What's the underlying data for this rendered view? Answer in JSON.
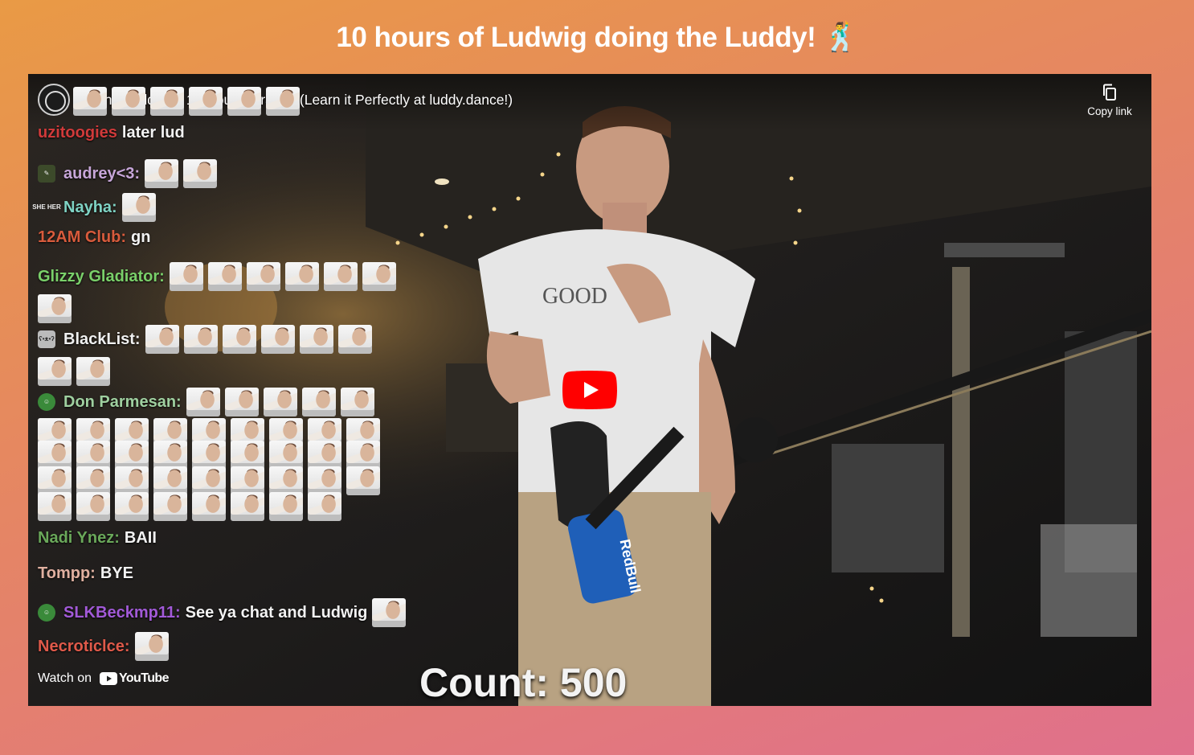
{
  "page": {
    "title": "10 hours of Ludwig doing the Luddy! 🕺"
  },
  "player": {
    "video_title": "The Luddy for 10 Hours Straight (Learn it Perfectly at luddy.dance!)",
    "copy_link_label": "Copy link",
    "watch_on_label": "Watch on",
    "youtube_label": "YouTube",
    "counter_label": "Count: 500",
    "shirt_text": "GOOD",
    "can_text": "RedBull"
  },
  "chat": [
    {
      "user": "uzitoogies",
      "text": "later lud",
      "color": "#d03a3a",
      "badge": ""
    },
    {
      "user": "audrey<3:",
      "text": "",
      "color": "#c7a6d9",
      "badge": "pencil"
    },
    {
      "user": "Nayha:",
      "text": "",
      "color": "#7fd3c4",
      "badge": "pronoun",
      "badge_text": "SHE HER"
    },
    {
      "user": "12AM Club:",
      "text": "gn",
      "color": "#d85b3c",
      "badge": ""
    },
    {
      "user": "Glizzy Gladiator:",
      "text": "",
      "color": "#7ad06a",
      "badge": ""
    },
    {
      "user": "BlackList:",
      "text": "",
      "color": "#f0f0f0",
      "badge": "bear"
    },
    {
      "user": "Don Parmesan:",
      "text": "",
      "color": "#9fd0a0",
      "badge": "smiley"
    },
    {
      "user": "Nadi Ynez:",
      "text": "BAII",
      "color": "#6aa85a",
      "badge": ""
    },
    {
      "user": "Tompp:",
      "text": "BYE",
      "color": "#e0b0a0",
      "badge": ""
    },
    {
      "user": "SLKBeckmp11:",
      "text": "See ya chat and Ludwig",
      "color": "#a25ad8",
      "badge": "smiley"
    },
    {
      "user": "Necroticlce:",
      "text": "",
      "color": "#e05a4a",
      "badge": ""
    }
  ],
  "colors": {
    "youtube_red": "#ff0000",
    "accent_orange": "#e99a45",
    "accent_pink": "#e0708c"
  },
  "icons": {
    "play": "play-icon",
    "copy": "copy-icon",
    "youtube": "youtube-logo-icon"
  }
}
